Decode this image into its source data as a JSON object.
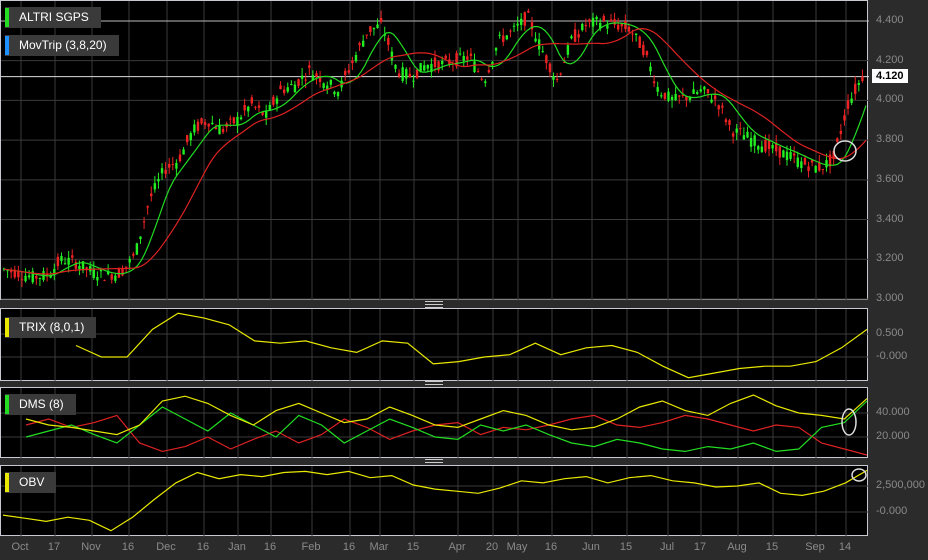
{
  "main": {
    "symbol": "ALTRI SGPS",
    "indicator": "MovTrip (3,8,20)",
    "last_price": "4.120",
    "symbol_color": "#22dd22",
    "indicator_color": "#1e90ff",
    "y_ticks": [
      "4.400",
      "4.200",
      "4.000",
      "3.800",
      "3.600",
      "3.400",
      "3.200",
      "3.000"
    ],
    "closes": [
      3.15,
      3.13,
      3.11,
      3.12,
      3.2,
      3.18,
      3.14,
      3.12,
      3.13,
      3.22,
      3.5,
      3.65,
      3.7,
      3.85,
      3.9,
      3.85,
      3.9,
      3.98,
      3.92,
      4.05,
      4.08,
      4.15,
      4.1,
      4.05,
      4.2,
      4.35,
      4.38,
      4.15,
      4.12,
      4.18,
      4.18,
      4.2,
      4.22,
      4.1,
      4.3,
      4.35,
      4.42,
      4.25,
      4.1,
      4.3,
      4.38,
      4.4,
      4.38,
      4.36,
      4.25,
      4.05,
      4.0,
      4.02,
      4.05,
      4.0,
      3.85,
      3.82,
      3.78,
      3.75,
      3.72,
      3.68,
      3.66,
      3.7,
      3.98,
      4.12
    ]
  },
  "trix": {
    "label": "TRIX (8,0,1)",
    "color": "#e8e800",
    "y_ticks": [
      "0.500",
      "-0.000"
    ],
    "values": [
      0.25,
      0.0,
      0.0,
      0.6,
      0.95,
      0.85,
      0.7,
      0.35,
      0.3,
      0.35,
      0.2,
      0.1,
      0.35,
      0.3,
      -0.15,
      -0.1,
      0.0,
      0.05,
      0.3,
      0.05,
      0.2,
      0.25,
      0.1,
      -0.2,
      -0.45,
      -0.35,
      -0.25,
      -0.2,
      -0.2,
      -0.1,
      0.2,
      0.6
    ]
  },
  "dms": {
    "label": "DMS (8)",
    "color": "#22dd22",
    "y_ticks": [
      "40.000",
      "20.000"
    ],
    "adx": [
      35,
      30,
      28,
      25,
      22,
      30,
      50,
      54,
      48,
      38,
      30,
      42,
      48,
      40,
      32,
      35,
      45,
      38,
      30,
      28,
      35,
      42,
      38,
      30,
      26,
      28,
      35,
      45,
      50,
      42,
      38,
      48,
      55,
      46,
      40,
      38,
      35,
      52
    ],
    "plus_di": [
      20,
      25,
      30,
      22,
      15,
      30,
      45,
      35,
      25,
      40,
      30,
      20,
      38,
      30,
      15,
      25,
      35,
      28,
      20,
      18,
      30,
      25,
      30,
      22,
      15,
      12,
      18,
      15,
      10,
      8,
      12,
      10,
      15,
      8,
      10,
      28,
      32,
      50
    ],
    "minus_di": [
      30,
      35,
      28,
      32,
      38,
      15,
      8,
      12,
      20,
      10,
      18,
      25,
      15,
      22,
      35,
      28,
      18,
      25,
      30,
      32,
      22,
      28,
      26,
      30,
      35,
      38,
      30,
      28,
      32,
      38,
      35,
      30,
      25,
      30,
      28,
      15,
      10,
      5
    ]
  },
  "obv": {
    "label": "OBV",
    "color": "#e8e800",
    "y_ticks": [
      "2,500,000",
      "-0.000"
    ],
    "values": [
      -0.3,
      -0.6,
      -0.9,
      -0.5,
      -0.8,
      -1.8,
      -0.5,
      1.2,
      2.8,
      3.8,
      3.2,
      3.6,
      3.4,
      3.8,
      3.9,
      3.6,
      3.9,
      3.3,
      3.5,
      2.6,
      2.2,
      2.0,
      1.8,
      2.3,
      3.0,
      2.8,
      3.2,
      3.4,
      2.8,
      3.3,
      3.5,
      3.0,
      2.8,
      2.4,
      2.5,
      2.8,
      1.8,
      1.6,
      2.0,
      2.8,
      4.0
    ]
  },
  "x_labels": [
    "Oct",
    "17",
    "Nov",
    "16",
    "Dec",
    "16",
    "Jan",
    "16",
    "Feb",
    "16",
    "Mar",
    "15",
    "Apr",
    "20",
    "May",
    "16",
    "Jun",
    "15",
    "Jul",
    "17",
    "Aug",
    "15",
    "Sep",
    "14"
  ],
  "colors": {
    "up": "#22ee22",
    "down": "#ee2222",
    "ma_fast": "#22dd22",
    "ma_slow": "#dd2222",
    "adx": "#e8e800"
  }
}
